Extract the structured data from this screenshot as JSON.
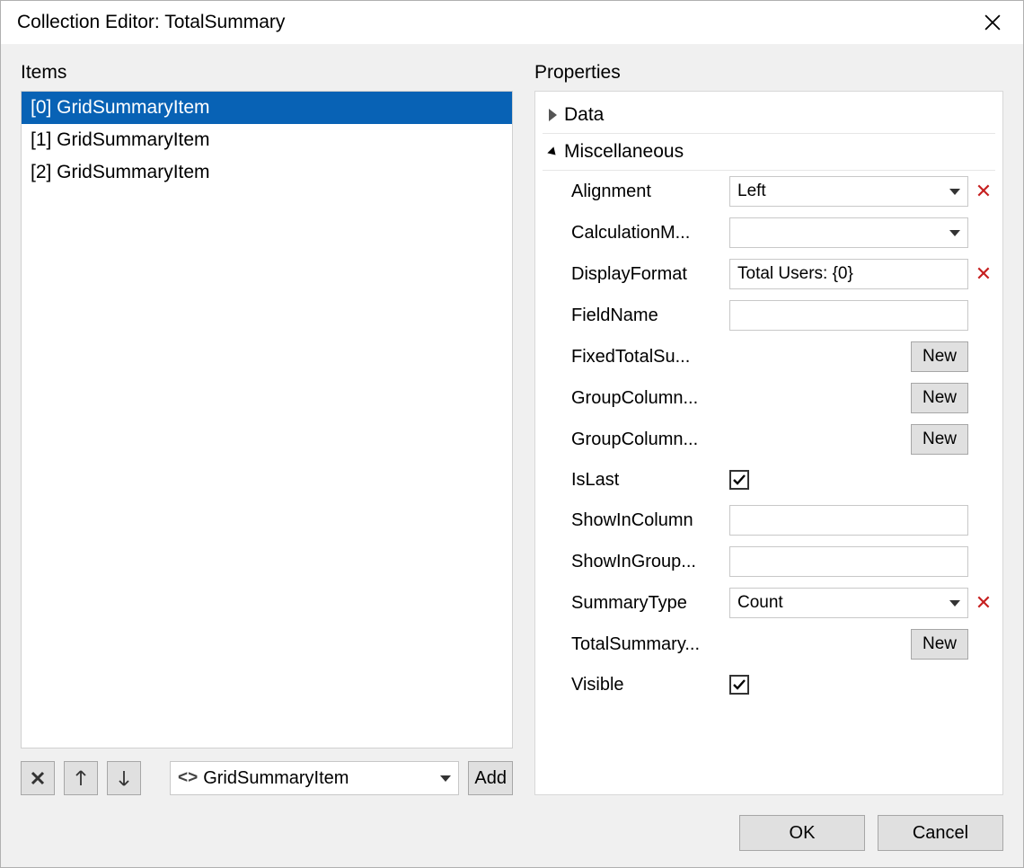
{
  "dialog": {
    "title": "Collection Editor: TotalSummary"
  },
  "left": {
    "heading": "Items",
    "items": [
      {
        "label": "[0] GridSummaryItem",
        "selected": true
      },
      {
        "label": "[1] GridSummaryItem",
        "selected": false
      },
      {
        "label": "[2] GridSummaryItem",
        "selected": false
      }
    ],
    "typeSelector": "GridSummaryItem",
    "addLabel": "Add"
  },
  "right": {
    "heading": "Properties",
    "categories": {
      "data": {
        "label": "Data",
        "expanded": false
      },
      "misc": {
        "label": "Miscellaneous",
        "expanded": true
      }
    },
    "props": {
      "alignment": {
        "label": "Alignment",
        "value": "Left"
      },
      "calcMode": {
        "label": "CalculationM...",
        "value": ""
      },
      "displayFormat": {
        "label": "DisplayFormat",
        "value": "Total Users: {0}"
      },
      "fieldName": {
        "label": "FieldName",
        "value": ""
      },
      "fixedTotal": {
        "label": "FixedTotalSu...",
        "button": "New"
      },
      "groupCol1": {
        "label": "GroupColumn...",
        "button": "New"
      },
      "groupCol2": {
        "label": "GroupColumn...",
        "button": "New"
      },
      "isLast": {
        "label": "IsLast",
        "checked": true
      },
      "showInCol": {
        "label": "ShowInColumn",
        "value": ""
      },
      "showInGroup": {
        "label": "ShowInGroup...",
        "value": ""
      },
      "summaryType": {
        "label": "SummaryType",
        "value": "Count"
      },
      "totalSummary": {
        "label": "TotalSummary...",
        "button": "New"
      },
      "visible": {
        "label": "Visible",
        "checked": true
      }
    }
  },
  "footer": {
    "ok": "OK",
    "cancel": "Cancel"
  }
}
